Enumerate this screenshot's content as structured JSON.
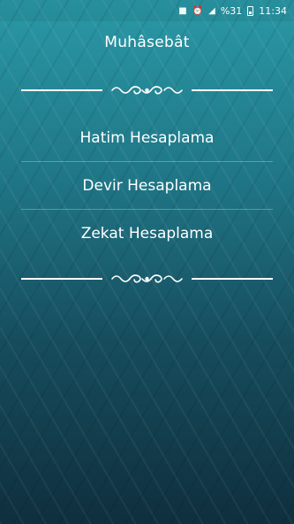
{
  "status_bar": {
    "battery": "%31",
    "time": "11:34"
  },
  "header": {
    "title": "Muhâsebât"
  },
  "menu": {
    "items": [
      {
        "label": "Hatim Hesaplama"
      },
      {
        "label": "Devir Hesaplama"
      },
      {
        "label": "Zekat Hesaplama"
      }
    ]
  },
  "icons": [
    "alarm-icon",
    "lock-icon",
    "signal-icon",
    "battery-icon",
    "ornament-icon"
  ]
}
